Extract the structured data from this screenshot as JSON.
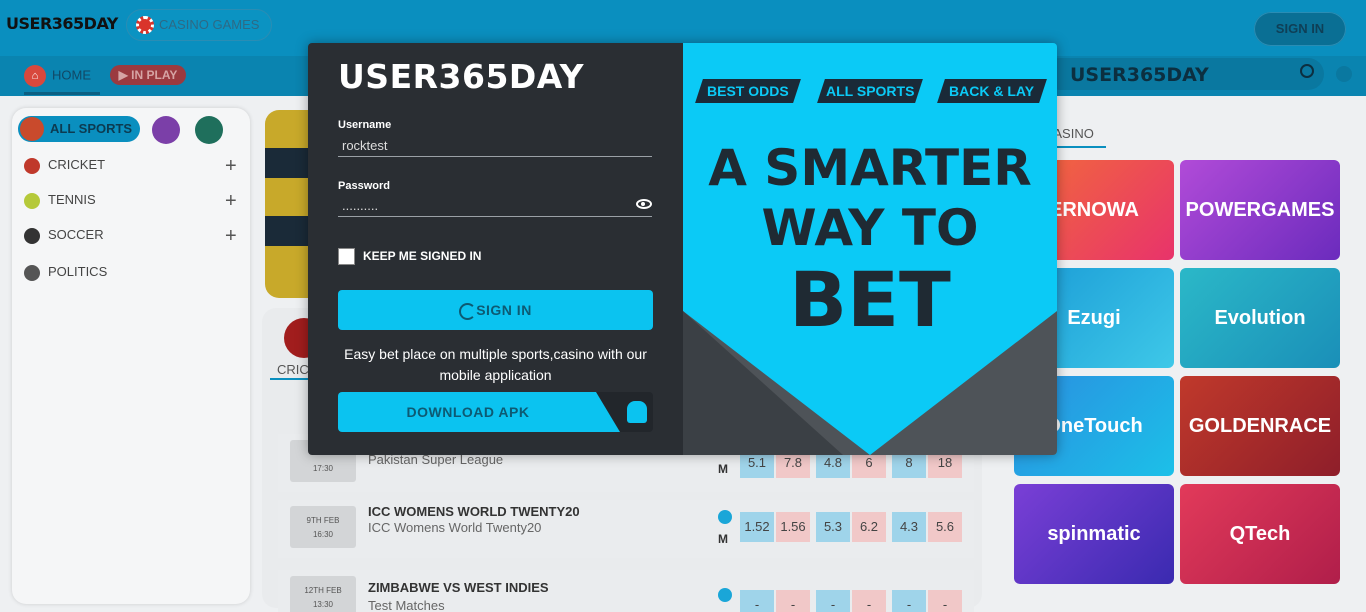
{
  "header": {
    "logo_text": "USER365DAY",
    "casino_games_label": "CASINO GAMES",
    "sign_in_label": "SIGN IN"
  },
  "nav": {
    "home_label": "HOME",
    "inplay_label": "IN PLAY"
  },
  "sidebar": {
    "all_sports_label": "ALL SPORTS",
    "items": [
      {
        "label": "CRICKET",
        "color": "#c0392b"
      },
      {
        "label": "TENNIS",
        "color": "#b5c93a"
      },
      {
        "label": "SOCCER",
        "color": "#333333"
      },
      {
        "label": "POLITICS",
        "color": "#555555"
      }
    ]
  },
  "content": {
    "cricket_tab": "CRICKET",
    "matches": [
      {
        "date": "",
        "time": "17:30",
        "title": "",
        "subtitle": "Pakistan Super League",
        "badge": "",
        "odds": [
          "5.1",
          "7.8",
          "4.8",
          "6",
          "8",
          "18"
        ]
      },
      {
        "date": "9TH FEB",
        "time": "16:30",
        "title": "ICC WOMENS WORLD TWENTY20",
        "subtitle": "ICC Womens World Twenty20",
        "badge": "",
        "odds": [
          "1.52",
          "1.56",
          "5.3",
          "6.2",
          "4.3",
          "5.6"
        ]
      },
      {
        "date": "12TH FEB",
        "time": "13:30",
        "title": "ZIMBABWE VS WEST INDIES",
        "subtitle": "Test Matches",
        "badge": "",
        "odds": [
          "-",
          "-",
          "-",
          "-",
          "-",
          "-"
        ]
      }
    ],
    "m_label": "M"
  },
  "right": {
    "logo_text": "USER365DAY",
    "casino_tab": "CASINO",
    "providers": [
      "ERNOWA",
      "POWERGAMES",
      "Ezugi",
      "Evolution",
      "OneTouch",
      "GOLDENRACE",
      "spinmatic",
      "QTech"
    ]
  },
  "modal": {
    "logo_text": "USER365DAY",
    "username_label": "Username",
    "username_value": "rocktest",
    "password_label": "Password",
    "password_value": "..........",
    "keep_signed_in": "KEEP ME SIGNED IN",
    "sign_in_label": "SIGN IN",
    "promo_text": "Easy bet place on multiple sports,casino with our mobile application",
    "download_label": "DOWNLOAD APK",
    "close_icon": "×",
    "tags": [
      "BEST ODDS",
      "ALL SPORTS",
      "BACK & LAY"
    ],
    "headline_1": "A SMARTER",
    "headline_2": "WAY TO",
    "headline_3": "BET"
  }
}
